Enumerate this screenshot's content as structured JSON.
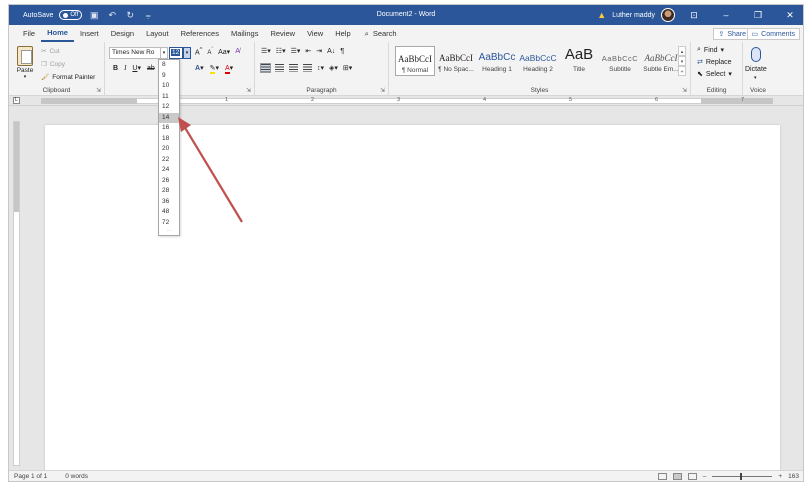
{
  "window": {
    "autosave_label": "AutoSave",
    "autosave_state": "Off",
    "title": "Document2 - Word",
    "user_name": "Luther maddy"
  },
  "tabs": [
    {
      "label": "File"
    },
    {
      "label": "Home"
    },
    {
      "label": "Insert"
    },
    {
      "label": "Design"
    },
    {
      "label": "Layout"
    },
    {
      "label": "References"
    },
    {
      "label": "Mailings"
    },
    {
      "label": "Review"
    },
    {
      "label": "View"
    },
    {
      "label": "Help"
    }
  ],
  "search_label": "Search",
  "share_label": "Share",
  "comments_label": "Comments",
  "clipboard": {
    "paste": "Paste",
    "cut": "Cut",
    "copy": "Copy",
    "format_painter": "Format Painter",
    "group_label": "Clipboard"
  },
  "font": {
    "font_name": "Times New Ro",
    "font_size": "12",
    "bold": "B",
    "italic": "I",
    "underline": "U",
    "strike": "ab",
    "grow": "A",
    "shrink": "A",
    "case": "Aa",
    "highlight": "A",
    "color": "A",
    "text_effects": "A"
  },
  "paragraph": {
    "sort": "A↓",
    "pilcrow": "¶",
    "group_label": "Paragraph"
  },
  "styles": {
    "group_label": "Styles",
    "items": [
      {
        "sample": "AaBbCcI",
        "name": "¶ Normal"
      },
      {
        "sample": "AaBbCcI",
        "name": "¶ No Spac..."
      },
      {
        "sample": "AaBbCc",
        "name": "Heading 1"
      },
      {
        "sample": "AaBbCcC",
        "name": "Heading 2"
      },
      {
        "sample": "AaB",
        "name": "Title"
      },
      {
        "sample": "AaBbCcC",
        "name": "Subtitle"
      },
      {
        "sample": "AaBbCcI",
        "name": "Subtle Em..."
      }
    ]
  },
  "editing": {
    "find": "Find",
    "replace": "Replace",
    "select": "Select",
    "group_label": "Editing"
  },
  "voice": {
    "dictate": "Dictate",
    "group_label": "Voice"
  },
  "ruler_ticks": [
    "1",
    "2",
    "3",
    "4",
    "5",
    "6",
    "7"
  ],
  "font_size_options": [
    "8",
    "9",
    "10",
    "11",
    "12",
    "14",
    "16",
    "18",
    "20",
    "22",
    "24",
    "26",
    "28",
    "36",
    "48",
    "72"
  ],
  "hovered_size": "14",
  "status": {
    "page": "Page 1 of 1",
    "words": "0 words",
    "zoom": "163"
  },
  "colors": {
    "title_bar": "#2b579a",
    "annotation_arrow": "#c0504d"
  }
}
